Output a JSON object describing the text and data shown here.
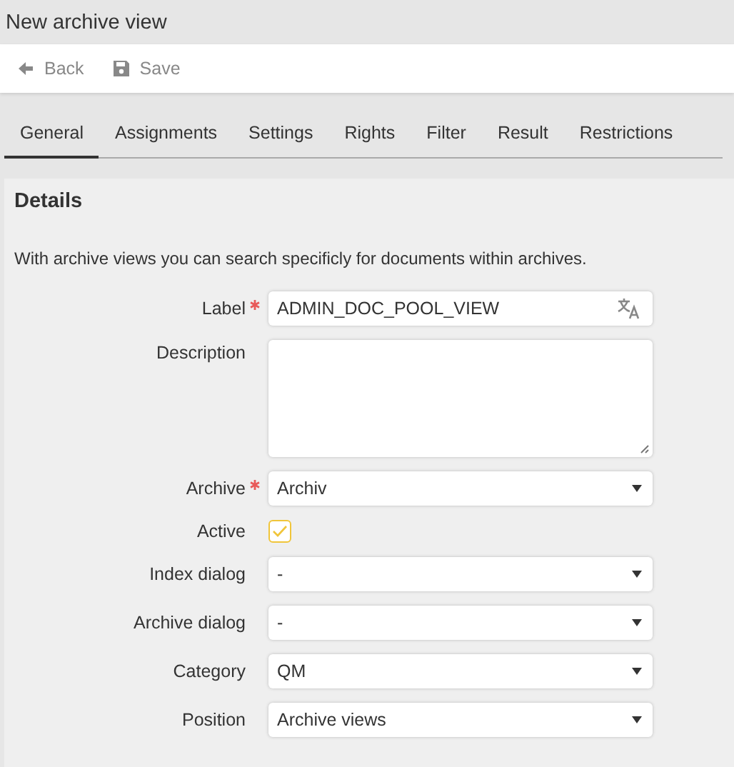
{
  "window": {
    "title": "New archive view"
  },
  "toolbar": [
    {
      "label": "Back",
      "kind": "back",
      "disabled": true
    },
    {
      "label": "Save",
      "kind": "save",
      "disabled": true
    }
  ],
  "tabs": [
    {
      "label": "General",
      "selected": true
    },
    {
      "label": "Assignments",
      "selected": false
    },
    {
      "label": "Settings",
      "selected": false
    },
    {
      "label": "Rights",
      "selected": false
    },
    {
      "label": "Filter",
      "selected": false
    },
    {
      "label": "Result",
      "selected": false
    },
    {
      "label": "Restrictions",
      "selected": false
    }
  ],
  "section": {
    "title": "Details",
    "description": "With archive views you can search specificly for documents within archives."
  },
  "fields": [
    {
      "label": "Label",
      "kind": "text",
      "required": true,
      "value": "ADMIN_DOC_POOL_VIEW"
    },
    {
      "label": "Description",
      "kind": "textarea",
      "required": false
    },
    {
      "label": "Archive",
      "kind": "select",
      "required": true,
      "value": "Archiv"
    },
    {
      "label": "Active",
      "kind": "checkbox",
      "required": false,
      "checked": true
    },
    {
      "label": "Index dialog",
      "kind": "select",
      "required": false,
      "value": "-"
    },
    {
      "label": "Archive dialog",
      "kind": "select",
      "required": false,
      "value": "-"
    },
    {
      "label": "Category",
      "kind": "select",
      "required": false,
      "value": "QM"
    },
    {
      "label": "Position",
      "kind": "select",
      "required": false,
      "value": "Archive views"
    }
  ]
}
